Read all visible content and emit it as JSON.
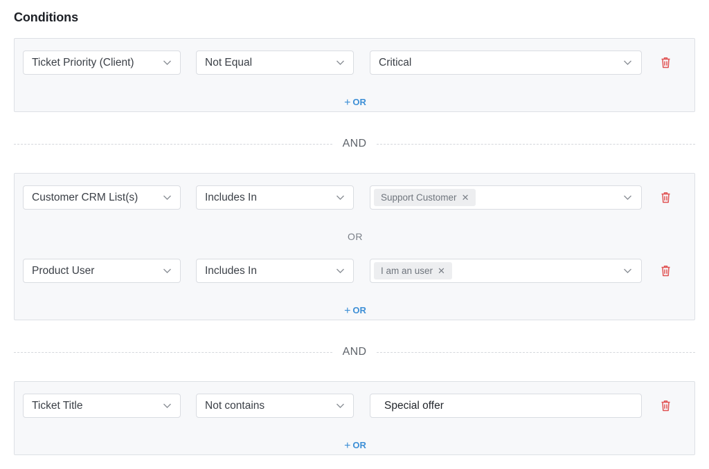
{
  "title": "Conditions",
  "groups": [
    {
      "rows": [
        {
          "field": "Ticket Priority (Client)",
          "operator": "Not Equal",
          "value": "Critical"
        }
      ],
      "add_or_label": "OR"
    },
    {
      "rows": [
        {
          "field": "Customer CRM List(s)",
          "operator": "Includes In",
          "tag": "Support Customer"
        },
        {
          "field": "Product User",
          "operator": "Includes In",
          "tag": "I am an user"
        }
      ],
      "or_between": "OR",
      "add_or_label": "OR"
    },
    {
      "rows": [
        {
          "field": "Ticket Title",
          "operator": "Not contains",
          "text_value": "Special offer"
        }
      ],
      "add_or_label": "OR"
    }
  ],
  "and_label": "AND",
  "icons": {
    "chevron": "chevron-down-icon",
    "delete": "trash-icon",
    "remove_tag": "close-icon",
    "add": "plus-icon"
  },
  "colors": {
    "accent": "#3d8fd6",
    "danger": "#e05252"
  }
}
